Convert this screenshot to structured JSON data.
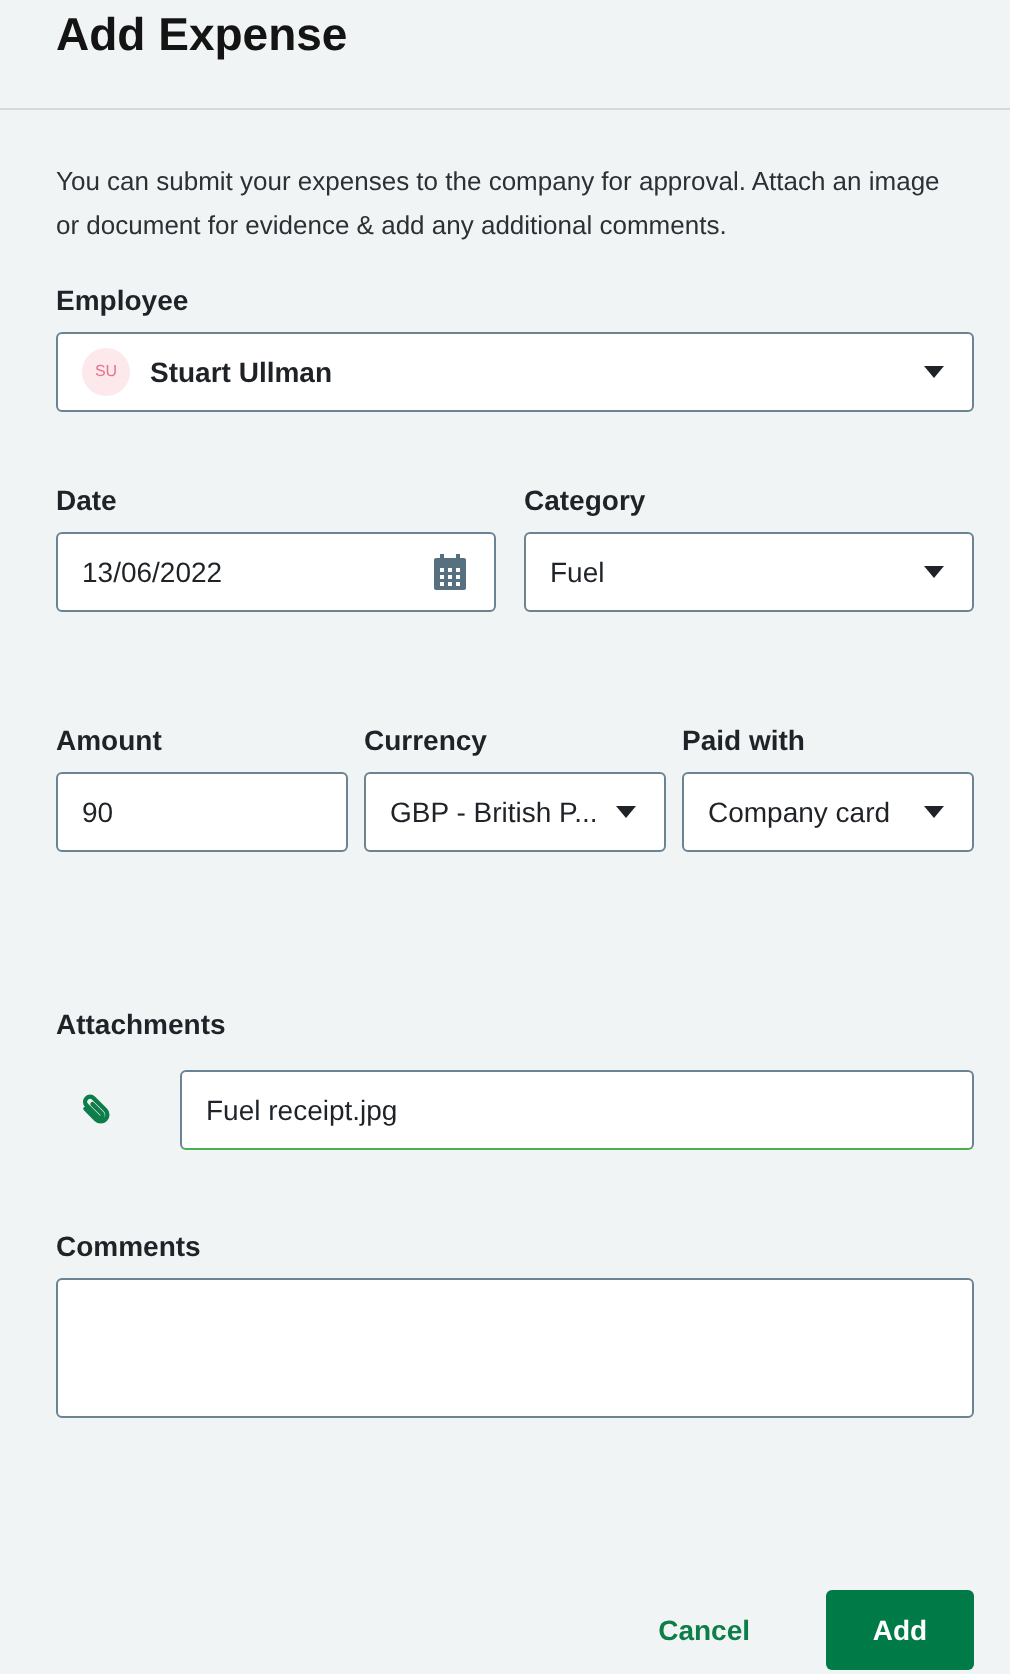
{
  "title": "Add Expense",
  "description": "You can submit your expenses to the company for approval. Attach an image or document for evidence & add any additional comments.",
  "employee": {
    "label": "Employee",
    "initials": "SU",
    "value": "Stuart Ullman"
  },
  "row_1": [
    {
      "label": "Date",
      "kind": "date",
      "value": "13/06/2022"
    },
    {
      "label": "Category",
      "kind": "select",
      "value": "Fuel"
    }
  ],
  "row_2": [
    {
      "label": "Amount",
      "kind": "text",
      "value": "90"
    },
    {
      "label": "Currency",
      "kind": "select",
      "value": "GBP - British P..."
    },
    {
      "label": "Paid with",
      "kind": "select",
      "value": "Company card"
    }
  ],
  "attachments": {
    "label": "Attachments",
    "value": "Fuel receipt.jpg"
  },
  "comments": {
    "label": "Comments"
  },
  "buttons": {
    "cancel": "Cancel",
    "add": "Add"
  }
}
